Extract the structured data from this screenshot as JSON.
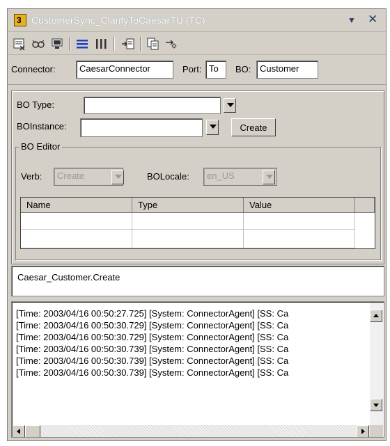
{
  "window": {
    "title": "CustomerSync_ClarifyToCaesarTU (TC)",
    "dropdown_glyph": "▼",
    "close_glyph": "✕"
  },
  "toolbar": {
    "icons": [
      "new-test-icon",
      "load-icon",
      "monitor-icon",
      "list-view-icon",
      "column-view-icon",
      "send-icon",
      "copy-icon",
      "reply-icon"
    ]
  },
  "connector_row": {
    "connector_label": "Connector:",
    "connector_value": "CaesarConnector",
    "port_label": "Port:",
    "port_value": "To",
    "bo_label": "BO:",
    "bo_value": "Customer"
  },
  "bo_panel": {
    "bo_type_label": "BO Type:",
    "bo_type_value": "",
    "bo_instance_label": "BOInstance:",
    "bo_instance_value": "",
    "create_button": "Create",
    "editor": {
      "legend": "BO Editor",
      "verb_label": "Verb:",
      "verb_value": "Create",
      "locale_label": "BOLocale:",
      "locale_value": "en_US",
      "columns": [
        "Name",
        "Type",
        "Value"
      ]
    }
  },
  "status_text": "Caesar_Customer.Create",
  "log": [
    "[Time: 2003/04/16 00:50:27.725] [System: ConnectorAgent] [SS: Ca",
    "[Time: 2003/04/16 00:50:30.729] [System: ConnectorAgent] [SS: Ca",
    "[Time: 2003/04/16 00:50:30.729] [System: ConnectorAgent] [SS: Ca",
    "[Time: 2003/04/16 00:50:30.739] [System: ConnectorAgent] [SS: Ca",
    "[Time: 2003/04/16 00:50:30.739] [System: ConnectorAgent] [SS: Ca",
    "[Time: 2003/04/16 00:50:30.739] [System: ConnectorAgent] [SS: Ca"
  ],
  "colors": {
    "window_bg": "#d4d0c8",
    "field_bg": "#ffffff"
  }
}
